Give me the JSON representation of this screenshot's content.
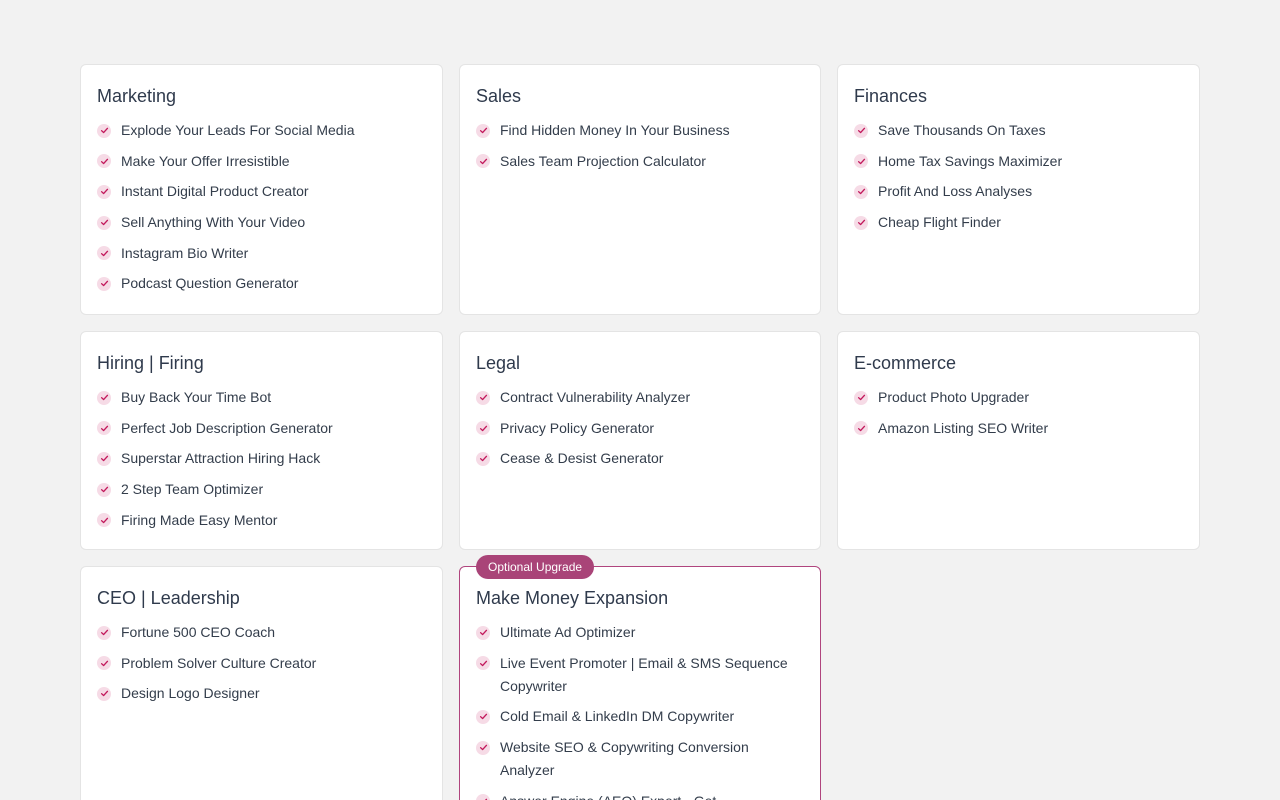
{
  "colors": {
    "page_background": "#f2f2f2",
    "card_background": "#ffffff",
    "accent": "#a94478",
    "check_background": "#f6dbe6"
  },
  "icons": {
    "check": "check-icon"
  },
  "categories": [
    {
      "title": "Marketing",
      "items": [
        "Explode Your Leads For Social Media",
        "Make Your Offer Irresistible",
        "Instant Digital Product Creator",
        "Sell Anything With Your Video",
        "Instagram Bio Writer",
        "Podcast Question Generator"
      ]
    },
    {
      "title": "Sales",
      "items": [
        "Find Hidden Money In Your Business",
        "Sales Team Projection Calculator"
      ]
    },
    {
      "title": "Finances",
      "items": [
        "Save Thousands On Taxes",
        "Home Tax Savings Maximizer",
        "Profit And Loss Analyses",
        "Cheap Flight Finder"
      ]
    },
    {
      "title": "Hiring | Firing",
      "items": [
        "Buy Back Your Time Bot",
        "Perfect Job Description Generator",
        "Superstar Attraction Hiring Hack",
        "2 Step Team Optimizer",
        "Firing Made Easy Mentor"
      ]
    },
    {
      "title": "Legal",
      "items": [
        "Contract Vulnerability Analyzer",
        "Privacy Policy Generator",
        "Cease & Desist Generator"
      ]
    },
    {
      "title": "E-commerce",
      "items": [
        "Product Photo Upgrader",
        "Amazon Listing SEO Writer"
      ]
    },
    {
      "title": "CEO | Leadership",
      "items": [
        "Fortune 500 CEO Coach",
        "Problem Solver Culture Creator",
        "Design Logo Designer"
      ]
    },
    {
      "title": "Make Money Expansion",
      "badge": "Optional Upgrade",
      "items": [
        "Ultimate Ad Optimizer",
        "Live Event Promoter | Email & SMS Sequence Copywriter",
        "Cold Email & LinkedIn DM Copywriter",
        "Website SEO & Copywriting Conversion Analyzer",
        "Answer Engine (AEO) Expert - Get Recommended By LLMs"
      ]
    }
  ]
}
